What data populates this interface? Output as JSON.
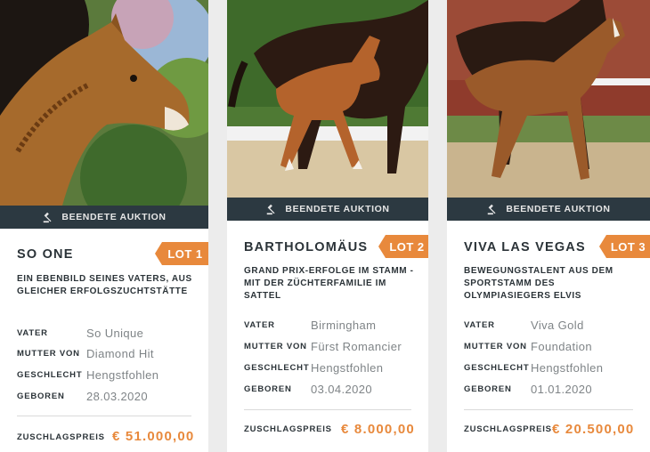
{
  "cards": [
    {
      "status": "BEENDETE AUKTION",
      "lot": "LOT 1",
      "name": "SO ONE",
      "tagline": "EIN EBENBILD SEINES VATERS, AUS GLEICHER ERFOLGSZUCHTSTÄTTE",
      "details": [
        {
          "label": "VATER",
          "value": "So Unique"
        },
        {
          "label": "MUTTER VON",
          "value": "Diamond Hit"
        },
        {
          "label": "GESCHLECHT",
          "value": "Hengstfohlen"
        },
        {
          "label": "GEBOREN",
          "value": "28.03.2020"
        }
      ],
      "price_label": "ZUSCHLAGSPREIS",
      "price": "€ 51.000,00"
    },
    {
      "status": "BEENDETE AUKTION",
      "lot": "LOT 2",
      "name": "BARTHOLOMÄUS",
      "tagline": "GRAND PRIX-ERFOLGE IM STAMM - MIT DER ZÜCHTERFAMILIE IM SATTEL",
      "details": [
        {
          "label": "VATER",
          "value": "Birmingham"
        },
        {
          "label": "MUTTER VON",
          "value": "Fürst Romancier"
        },
        {
          "label": "GESCHLECHT",
          "value": "Hengstfohlen"
        },
        {
          "label": "GEBOREN",
          "value": "03.04.2020"
        }
      ],
      "price_label": "ZUSCHLAGSPREIS",
      "price": "€ 8.000,00"
    },
    {
      "status": "BEENDETE AUKTION",
      "lot": "LOT 3",
      "name": "VIVA LAS VEGAS",
      "tagline": "BEWEGUNGSTALENT AUS DEM SPORTSTAMM DES OLYMPIASIEGERS ELVIS",
      "details": [
        {
          "label": "VATER",
          "value": "Viva Gold"
        },
        {
          "label": "MUTTER VON",
          "value": "Foundation"
        },
        {
          "label": "GESCHLECHT",
          "value": "Hengstfohlen"
        },
        {
          "label": "GEBOREN",
          "value": "01.01.2020"
        }
      ],
      "price_label": "ZUSCHLAGSPREIS",
      "price": "€ 20.500,00"
    }
  ],
  "colors": {
    "accent": "#e8893c",
    "bar": "#2c3941",
    "text": "#2b3338",
    "muted": "#7f8487"
  },
  "icons": {
    "status": "gavel-icon"
  }
}
